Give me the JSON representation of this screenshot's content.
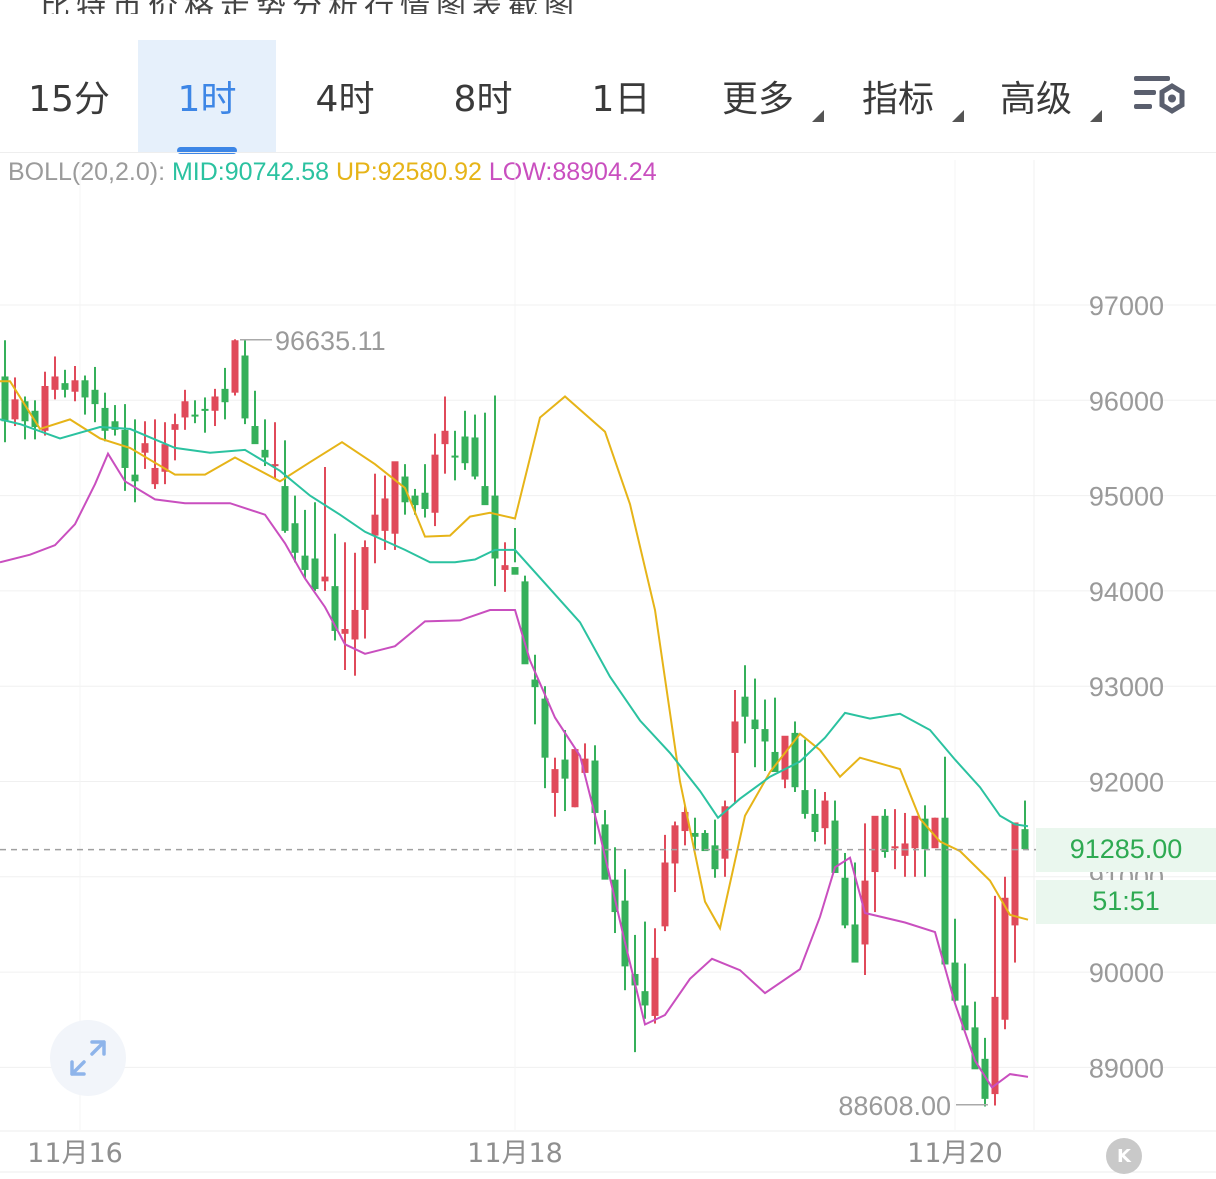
{
  "tabs": [
    {
      "label": "15分",
      "active": false
    },
    {
      "label": "1时",
      "active": true
    },
    {
      "label": "4时",
      "active": false
    },
    {
      "label": "8时",
      "active": false
    },
    {
      "label": "1日",
      "active": false
    },
    {
      "label": "更多",
      "active": false,
      "dropdown": true
    },
    {
      "label": "指标",
      "active": false,
      "dropdown": true
    },
    {
      "label": "高级",
      "active": false,
      "dropdown": true
    }
  ],
  "settings_icon": "chart-settings-icon",
  "boll": {
    "name": "BOLL(20,2.0):",
    "mid": "MID:90742.58",
    "up": "UP:92580.92",
    "low": "LOW:88904.24"
  },
  "current_price": "91285.00",
  "countdown": "51:51",
  "annotations": {
    "high": "96635.11",
    "low": "88608.00"
  },
  "colors": {
    "up_candle": "#e04a5a",
    "down_candle": "#35b05a",
    "mid": "#2bc2a0",
    "upper": "#e6b418",
    "lower": "#c94fbf",
    "active_tab": "#3d86e6"
  },
  "chart_data": {
    "type": "candlestick",
    "y_ticks": [
      "97000",
      "96000",
      "95000",
      "94000",
      "93000",
      "92000",
      "91000",
      "90000",
      "89000"
    ],
    "x_labels": [
      "11月16",
      "11月18",
      "11月20"
    ],
    "ylim": [
      88400,
      97800
    ],
    "price_line": 91285,
    "grid": true,
    "upper_band": [
      [
        0,
        96200
      ],
      [
        10,
        96200
      ],
      [
        40,
        95700
      ],
      [
        70,
        95800
      ],
      [
        100,
        95600
      ],
      [
        130,
        95500
      ],
      [
        175,
        95220
      ],
      [
        205,
        95220
      ],
      [
        235,
        95400
      ],
      [
        280,
        95150
      ],
      [
        310,
        95350
      ],
      [
        342,
        95560
      ],
      [
        375,
        95330
      ],
      [
        405,
        95080
      ],
      [
        425,
        94570
      ],
      [
        450,
        94580
      ],
      [
        470,
        94780
      ],
      [
        490,
        94820
      ],
      [
        515,
        94760
      ],
      [
        540,
        95820
      ],
      [
        565,
        96040
      ],
      [
        605,
        95670
      ],
      [
        630,
        94910
      ],
      [
        655,
        93800
      ],
      [
        680,
        92000
      ],
      [
        705,
        90740
      ],
      [
        720,
        90460
      ],
      [
        745,
        91640
      ],
      [
        770,
        92100
      ],
      [
        800,
        92500
      ],
      [
        820,
        92330
      ],
      [
        840,
        92050
      ],
      [
        860,
        92250
      ],
      [
        900,
        92130
      ],
      [
        920,
        91610
      ],
      [
        940,
        91370
      ],
      [
        960,
        91270
      ],
      [
        990,
        90960
      ],
      [
        1010,
        90600
      ],
      [
        1028,
        90550
      ]
    ],
    "mid_band": [
      [
        0,
        95800
      ],
      [
        20,
        95750
      ],
      [
        60,
        95600
      ],
      [
        100,
        95720
      ],
      [
        130,
        95700
      ],
      [
        175,
        95500
      ],
      [
        210,
        95450
      ],
      [
        245,
        95480
      ],
      [
        280,
        95260
      ],
      [
        310,
        95000
      ],
      [
        340,
        94800
      ],
      [
        365,
        94620
      ],
      [
        405,
        94430
      ],
      [
        430,
        94300
      ],
      [
        455,
        94300
      ],
      [
        475,
        94330
      ],
      [
        495,
        94430
      ],
      [
        515,
        94430
      ],
      [
        545,
        94080
      ],
      [
        580,
        93670
      ],
      [
        610,
        93100
      ],
      [
        640,
        92640
      ],
      [
        670,
        92300
      ],
      [
        700,
        91900
      ],
      [
        718,
        91620
      ],
      [
        740,
        91820
      ],
      [
        770,
        92050
      ],
      [
        800,
        92210
      ],
      [
        825,
        92460
      ],
      [
        845,
        92720
      ],
      [
        870,
        92660
      ],
      [
        900,
        92710
      ],
      [
        930,
        92540
      ],
      [
        955,
        92230
      ],
      [
        980,
        91940
      ],
      [
        1000,
        91640
      ],
      [
        1015,
        91550
      ],
      [
        1028,
        91530
      ]
    ],
    "lower_band": [
      [
        0,
        94300
      ],
      [
        30,
        94380
      ],
      [
        55,
        94480
      ],
      [
        75,
        94700
      ],
      [
        95,
        95120
      ],
      [
        108,
        95440
      ],
      [
        125,
        95150
      ],
      [
        155,
        94960
      ],
      [
        185,
        94920
      ],
      [
        230,
        94920
      ],
      [
        265,
        94800
      ],
      [
        285,
        94500
      ],
      [
        305,
        94130
      ],
      [
        325,
        93830
      ],
      [
        345,
        93440
      ],
      [
        365,
        93340
      ],
      [
        395,
        93420
      ],
      [
        425,
        93680
      ],
      [
        460,
        93690
      ],
      [
        490,
        93800
      ],
      [
        515,
        93800
      ],
      [
        530,
        93270
      ],
      [
        555,
        92670
      ],
      [
        580,
        92270
      ],
      [
        600,
        91440
      ],
      [
        625,
        90310
      ],
      [
        645,
        89450
      ],
      [
        665,
        89550
      ],
      [
        690,
        89930
      ],
      [
        712,
        90140
      ],
      [
        740,
        90020
      ],
      [
        765,
        89780
      ],
      [
        800,
        90030
      ],
      [
        820,
        90580
      ],
      [
        835,
        91100
      ],
      [
        850,
        91200
      ],
      [
        865,
        90620
      ],
      [
        905,
        90520
      ],
      [
        935,
        90420
      ],
      [
        955,
        89670
      ],
      [
        975,
        89070
      ],
      [
        992,
        88790
      ],
      [
        1010,
        88930
      ],
      [
        1028,
        88900
      ]
    ],
    "candles": [
      [
        5,
        96250,
        96630,
        95560,
        95780
      ],
      [
        15,
        95800,
        96240,
        95730,
        96010
      ],
      [
        25,
        95990,
        96040,
        95590,
        95780
      ],
      [
        35,
        95890,
        96000,
        95590,
        95720
      ],
      [
        45,
        95680,
        96300,
        95630,
        96150
      ],
      [
        55,
        96110,
        96460,
        96010,
        96250
      ],
      [
        65,
        96180,
        96320,
        96030,
        96110
      ],
      [
        75,
        96090,
        96360,
        95990,
        96210
      ],
      [
        85,
        96210,
        96260,
        95850,
        96030
      ],
      [
        95,
        96110,
        96350,
        95770,
        95960
      ],
      [
        105,
        95920,
        96080,
        95570,
        95680
      ],
      [
        115,
        95780,
        95950,
        95630,
        95690
      ],
      [
        125,
        95690,
        95960,
        95050,
        95290
      ],
      [
        135,
        95220,
        95800,
        94930,
        95150
      ],
      [
        145,
        95450,
        95780,
        95280,
        95550
      ],
      [
        155,
        95120,
        95800,
        95070,
        95290
      ],
      [
        165,
        95250,
        95770,
        95120,
        95540
      ],
      [
        175,
        95690,
        95860,
        95370,
        95750
      ],
      [
        185,
        95820,
        96110,
        95690,
        95990
      ],
      [
        195,
        95850,
        96000,
        95760,
        95830
      ],
      [
        205,
        95910,
        96030,
        95660,
        95890
      ],
      [
        215,
        95890,
        96120,
        95730,
        96040
      ],
      [
        225,
        96120,
        96340,
        95800,
        95980
      ],
      [
        235,
        96080,
        96640,
        96050,
        96630
      ],
      [
        245,
        96470,
        96630,
        95750,
        95810
      ],
      [
        255,
        95730,
        96100,
        95580,
        95540
      ],
      [
        265,
        95480,
        95800,
        95310,
        95400
      ],
      [
        275,
        95320,
        95770,
        95170,
        95330
      ],
      [
        285,
        95100,
        95580,
        94610,
        94630
      ],
      [
        295,
        94710,
        95000,
        94300,
        94400
      ],
      [
        305,
        94370,
        94850,
        94130,
        94220
      ],
      [
        315,
        94340,
        94930,
        94000,
        94020
      ],
      [
        325,
        94100,
        95300,
        94000,
        94150
      ],
      [
        335,
        94050,
        94600,
        93480,
        93580
      ],
      [
        345,
        93550,
        94510,
        93170,
        93600
      ],
      [
        355,
        93490,
        94400,
        93110,
        93800
      ],
      [
        365,
        93800,
        94530,
        93500,
        94460
      ],
      [
        375,
        94580,
        95230,
        94290,
        94800
      ],
      [
        385,
        94630,
        95210,
        94430,
        94970
      ],
      [
        395,
        94600,
        95330,
        94430,
        95360
      ],
      [
        405,
        95200,
        95330,
        94800,
        94930
      ],
      [
        415,
        95000,
        95070,
        94800,
        94900
      ],
      [
        425,
        95030,
        95330,
        94770,
        94860
      ],
      [
        435,
        94820,
        95650,
        94680,
        95430
      ],
      [
        445,
        95540,
        96040,
        95230,
        95680
      ],
      [
        455,
        95420,
        95680,
        95160,
        95400
      ],
      [
        465,
        95620,
        95890,
        95270,
        95340
      ],
      [
        475,
        95610,
        95850,
        95170,
        95200
      ],
      [
        485,
        95100,
        95870,
        94950,
        94900
      ],
      [
        495,
        95000,
        96050,
        94050,
        94340
      ],
      [
        505,
        94220,
        94510,
        93990,
        94270
      ],
      [
        515,
        94250,
        94660,
        94300,
        94170
      ],
      [
        525,
        94100,
        94160,
        93290,
        93230
      ],
      [
        535,
        93070,
        93330,
        92600,
        92990
      ],
      [
        545,
        92870,
        93000,
        91930,
        92250
      ],
      [
        555,
        91880,
        92250,
        91630,
        92130
      ],
      [
        565,
        92230,
        92540,
        91690,
        92030
      ],
      [
        575,
        91730,
        92330,
        91730,
        92340
      ],
      [
        585,
        92090,
        92400,
        92180,
        92240
      ],
      [
        595,
        92220,
        92380,
        91340,
        91670
      ],
      [
        605,
        91550,
        91700,
        91030,
        90970
      ],
      [
        615,
        90970,
        91310,
        90410,
        90630
      ],
      [
        625,
        90750,
        91080,
        89810,
        90060
      ],
      [
        635,
        89980,
        90390,
        89160,
        89860
      ],
      [
        645,
        89800,
        90530,
        89510,
        89650
      ],
      [
        655,
        89540,
        90460,
        89460,
        90150
      ],
      [
        665,
        90480,
        91440,
        90430,
        91150
      ],
      [
        675,
        91140,
        91580,
        90840,
        91540
      ],
      [
        685,
        91480,
        91740,
        91330,
        91680
      ],
      [
        695,
        91460,
        91620,
        91290,
        91420
      ],
      [
        705,
        91460,
        91490,
        91430,
        91270
      ],
      [
        715,
        91330,
        91600,
        90990,
        91080
      ],
      [
        725,
        91190,
        91800,
        91000,
        91740
      ],
      [
        735,
        92300,
        92960,
        91770,
        92630
      ],
      [
        745,
        92890,
        93220,
        92400,
        92680
      ],
      [
        755,
        92650,
        93080,
        92150,
        92550
      ],
      [
        765,
        92550,
        92860,
        92110,
        92420
      ],
      [
        775,
        92310,
        92880,
        92150,
        92100
      ],
      [
        785,
        92020,
        92450,
        91930,
        92480
      ],
      [
        795,
        92510,
        92630,
        91890,
        91940
      ],
      [
        805,
        91910,
        92440,
        91610,
        91660
      ],
      [
        815,
        91660,
        91920,
        91370,
        91470
      ],
      [
        825,
        91510,
        91890,
        91340,
        91800
      ],
      [
        835,
        91590,
        91800,
        91100,
        91040
      ],
      [
        845,
        90990,
        91250,
        90460,
        90490
      ],
      [
        855,
        90500,
        91150,
        90160,
        90100
      ],
      [
        865,
        90290,
        91560,
        89970,
        90960
      ],
      [
        875,
        91050,
        91610,
        90630,
        91640
      ],
      [
        885,
        91640,
        91710,
        91200,
        91260
      ],
      [
        895,
        91300,
        91710,
        91080,
        91320
      ],
      [
        905,
        91220,
        91670,
        91000,
        91350
      ],
      [
        915,
        91300,
        91420,
        91000,
        91640
      ],
      [
        925,
        91610,
        91750,
        91000,
        91290
      ],
      [
        935,
        91300,
        91620,
        91330,
        91620
      ],
      [
        945,
        91620,
        92260,
        91070,
        90080
      ],
      [
        955,
        90100,
        90560,
        89690,
        89700
      ],
      [
        965,
        89650,
        90090,
        89450,
        89390
      ],
      [
        975,
        89420,
        89690,
        89010,
        88980
      ],
      [
        985,
        89090,
        89310,
        88590,
        88670
      ],
      [
        995,
        88720,
        90800,
        88600,
        89740
      ],
      [
        1005,
        89500,
        91000,
        89400,
        90780
      ],
      [
        1015,
        90490,
        91300,
        90100,
        91570
      ],
      [
        1025,
        91500,
        91800,
        91310,
        91290
      ]
    ]
  }
}
